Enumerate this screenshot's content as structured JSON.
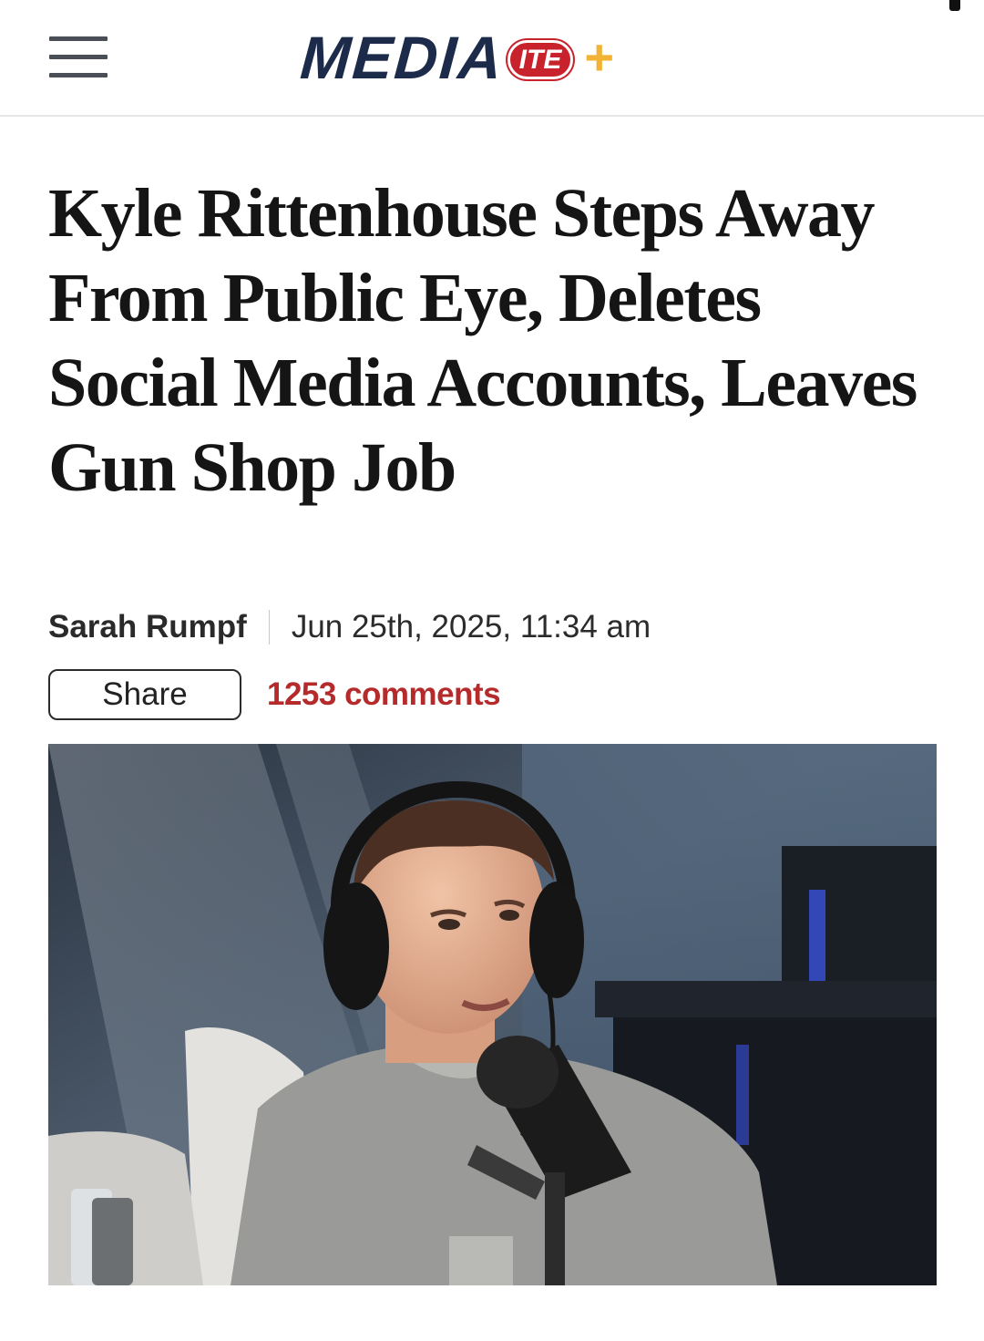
{
  "header": {
    "logo_text": "MEDIA",
    "logo_badge": "ITE",
    "logo_plus": "+",
    "menu_icon": "hamburger-menu-icon"
  },
  "article": {
    "headline": "Kyle Rittenhouse Steps Away From Public Eye, Deletes Social Media Accounts, Leaves Gun Shop Job",
    "author": "Sarah Rumpf",
    "date": "Jun 25th, 2025, 11:34 am",
    "share_label": "Share",
    "comments_label": "1253 comments"
  },
  "colors": {
    "brand_navy": "#1c2b49",
    "brand_red": "#c8232c",
    "brand_plus": "#f2b233",
    "comments_red": "#b52a2a"
  }
}
